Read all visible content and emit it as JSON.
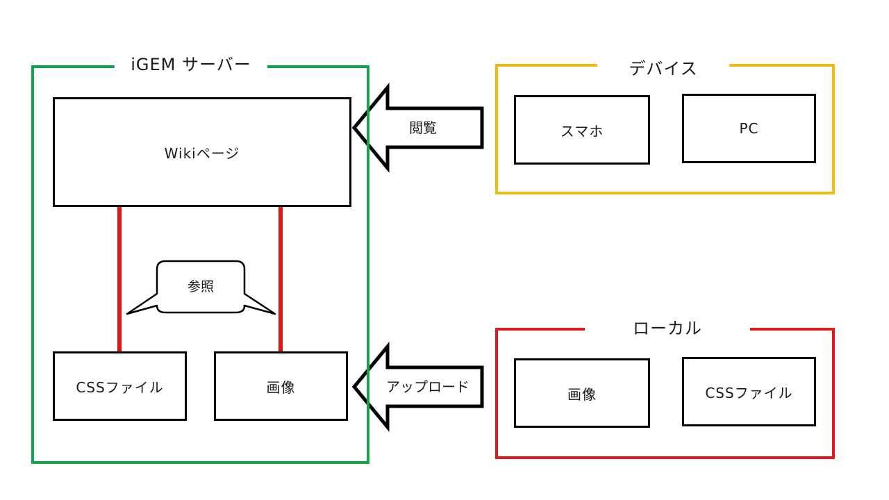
{
  "colors": {
    "server_frame": "#12a64a",
    "device_frame": "#edbb17",
    "local_frame": "#e21b1b",
    "reference_line": "#df1414",
    "box_border": "#000000"
  },
  "server": {
    "title": "iGEM サーバー",
    "wiki_page": "Wikiページ",
    "css_file": "CSSファイル",
    "image": "画像",
    "callout": "参照"
  },
  "device": {
    "title": "デバイス",
    "smartphone": "スマホ",
    "pc": "PC"
  },
  "local": {
    "title": "ローカル",
    "image": "画像",
    "css_file": "CSSファイル"
  },
  "arrows": {
    "browse": "閲覧",
    "upload": "アップロード"
  }
}
